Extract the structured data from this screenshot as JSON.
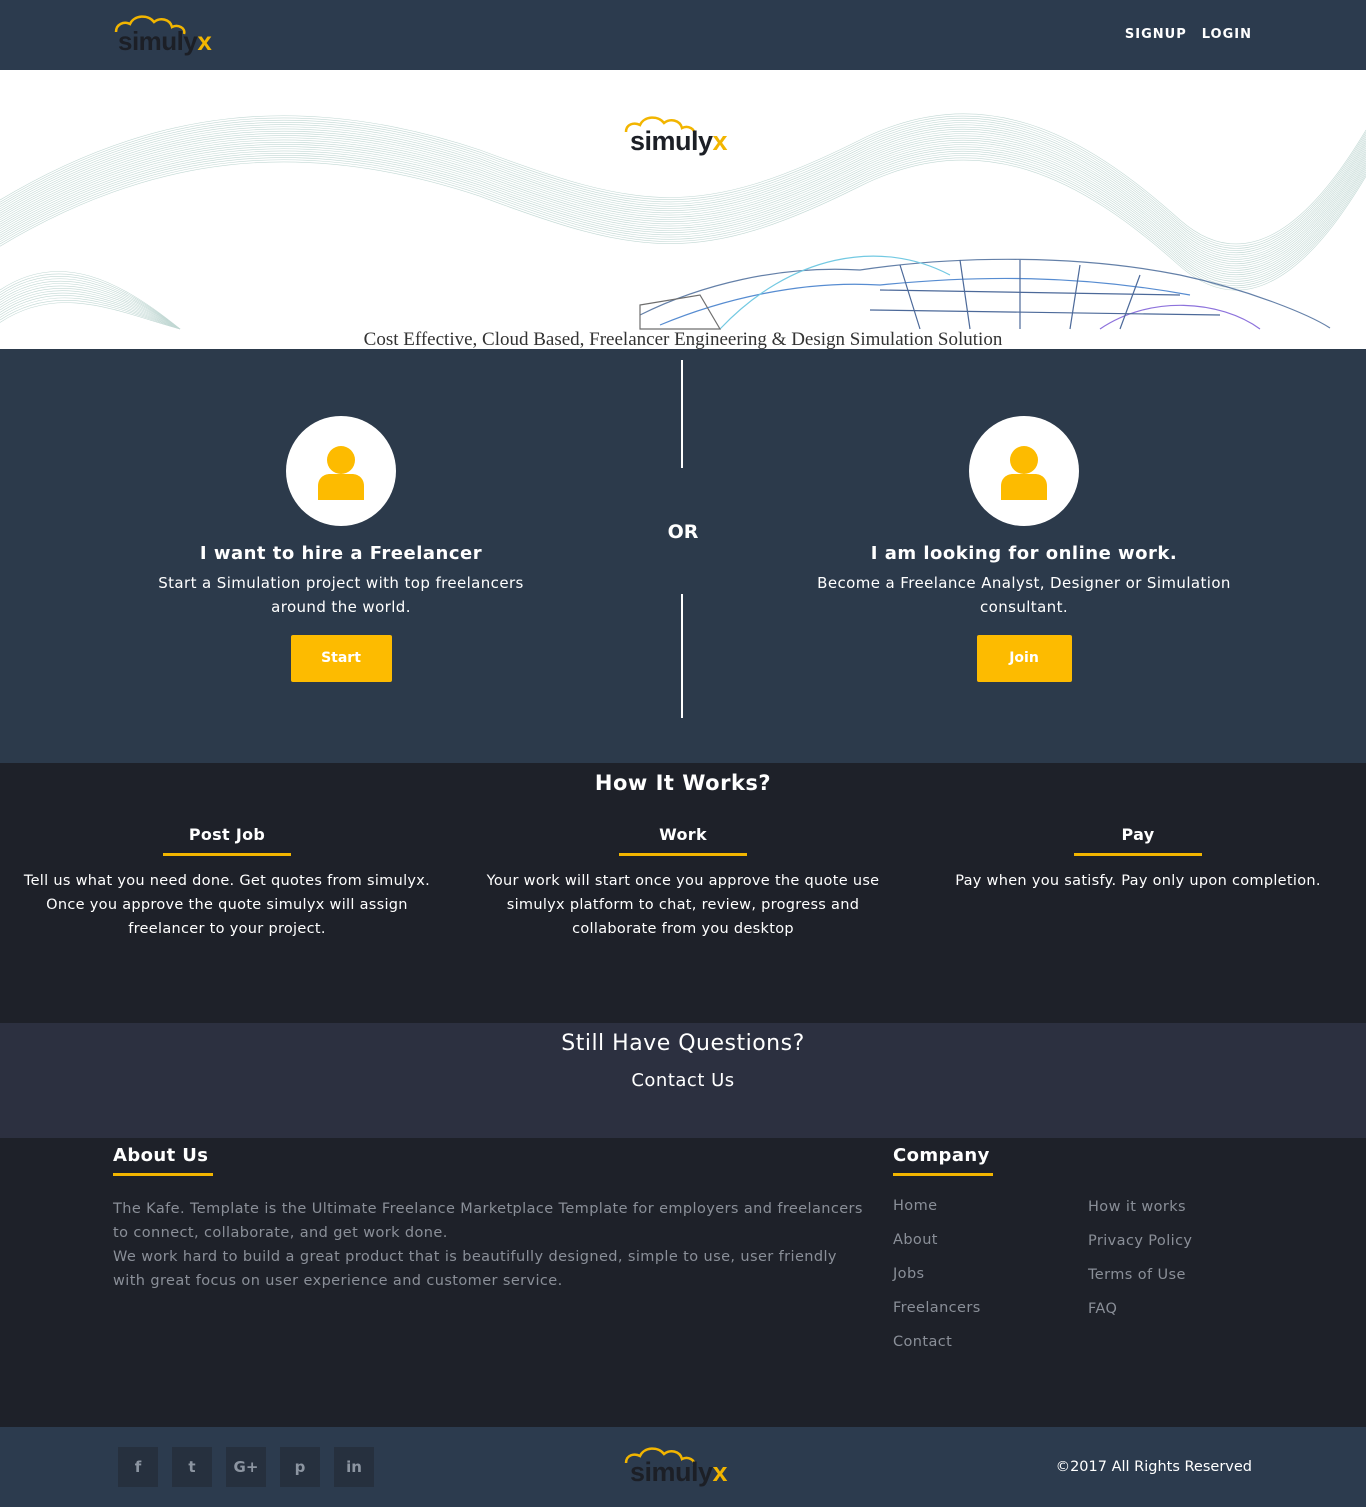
{
  "brand": {
    "name_main": "simuly",
    "name_accent": "x",
    "accent_color": "#f2b500"
  },
  "header": {
    "signup_label": "SIGNUP",
    "login_label": "LOGIN"
  },
  "hero": {
    "tagline": "Cost Effective, Cloud Based, Freelancer Engineering & Design Simulation Solution"
  },
  "choose": {
    "or_label": "OR",
    "hire": {
      "icon": "user-icon",
      "title": "I want to hire a Freelancer",
      "description": "Start a Simulation project with top freelancers around the world.",
      "button_label": "Start"
    },
    "work": {
      "icon": "user-icon",
      "title": "I am looking for online work.",
      "description": "Become a Freelance Analyst, Designer or Simulation consultant.",
      "button_label": "Join"
    },
    "button_color": "#fdbb00"
  },
  "how_it_works": {
    "title": "How It Works?",
    "steps": [
      {
        "title": "Post Job",
        "text": "Tell us what you need done. Get quotes from simulyx. Once you approve the quote simulyx will assign freelancer to your project."
      },
      {
        "title": "Work",
        "text": "Your work will start once you approve the quote use simulyx platform to chat, review, progress and collaborate from you desktop"
      },
      {
        "title": "Pay",
        "text": "Pay when you satisfy. Pay only upon completion."
      }
    ]
  },
  "questions": {
    "title": "Still Have Questions?",
    "contact_label": "Contact Us"
  },
  "footer": {
    "about": {
      "title": "About Us",
      "paragraph_1": "The Kafe. Template is the Ultimate Freelance Marketplace Template for employers and freelancers to connect, collaborate, and get work done.",
      "paragraph_2": "We work hard to build a great product that is beautifully designed, simple to use, user friendly with great focus on user experience and customer service."
    },
    "company": {
      "title": "Company",
      "links_col1": [
        "Home",
        "About",
        "Jobs",
        "Freelancers",
        "Contact"
      ],
      "links_col2": [
        "How it works",
        "Privacy Policy",
        "Terms of Use",
        "FAQ"
      ]
    }
  },
  "bottom_bar": {
    "social": [
      {
        "icon": "facebook-icon",
        "glyph": "f"
      },
      {
        "icon": "twitter-icon",
        "glyph": "t"
      },
      {
        "icon": "google-plus-icon",
        "glyph": "G+"
      },
      {
        "icon": "pinterest-icon",
        "glyph": "p"
      },
      {
        "icon": "linkedin-icon",
        "glyph": "in"
      }
    ],
    "copyright": "©2017 All Rights Reserved"
  }
}
